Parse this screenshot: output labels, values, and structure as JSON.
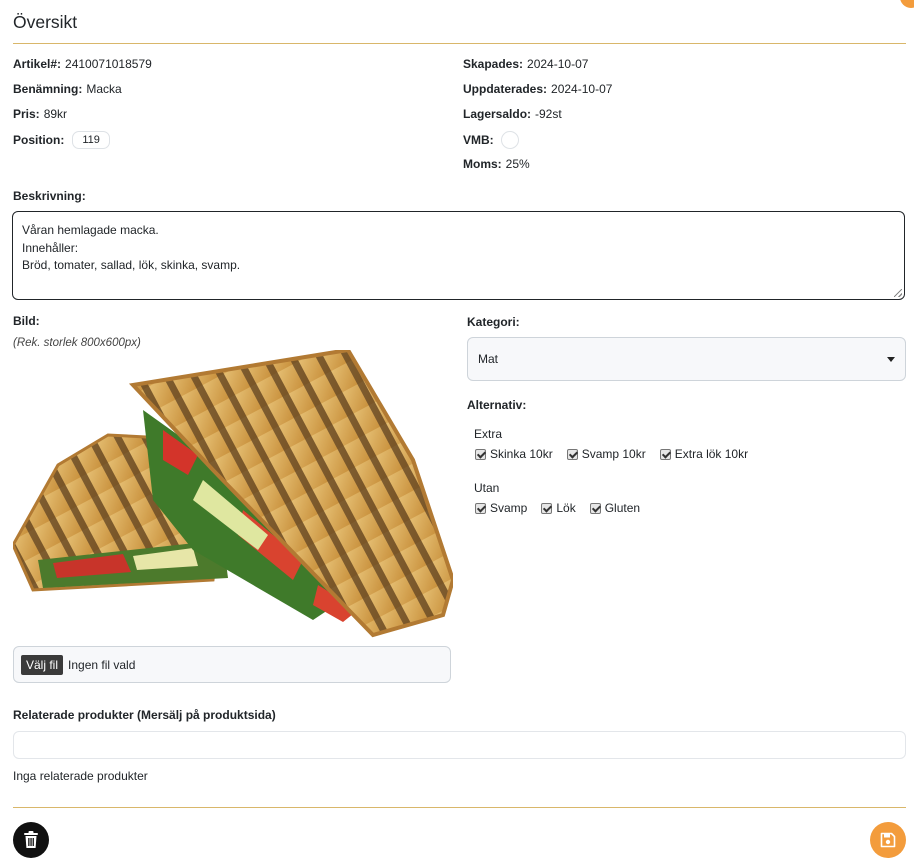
{
  "header": {
    "title": "Översikt"
  },
  "details_left": [
    {
      "label": "Artikel#:",
      "value": "2410071018579"
    },
    {
      "label": "Benämning:",
      "value": "Macka"
    },
    {
      "label": "Pris:",
      "value": "89kr"
    },
    {
      "label": "Position:",
      "value": "119"
    }
  ],
  "details_right": [
    {
      "label": "Skapades:",
      "value": "2024-10-07"
    },
    {
      "label": "Uppdaterades:",
      "value": "2024-10-07"
    },
    {
      "label": "Lagersaldo:",
      "value": "-92st"
    },
    {
      "label": "VMB:",
      "value": ""
    },
    {
      "label": "Moms:",
      "value": "25%"
    }
  ],
  "description": {
    "label": "Beskrivning:",
    "lines": [
      "Våran hemlagade macka.",
      "Innehåller:",
      "Bröd, tomater, sallad, lök, skinka, svamp."
    ]
  },
  "image": {
    "label": "Bild:",
    "hint": "(Rek. storlek 800x600px)",
    "file_button": "Välj fil",
    "file_status": "Ingen fil vald"
  },
  "category": {
    "label": "Kategori:",
    "selected": "Mat"
  },
  "options": {
    "label": "Alternativ:",
    "groups": [
      {
        "title": "Extra",
        "items": [
          {
            "label": "Skinka 10kr",
            "checked": true
          },
          {
            "label": "Svamp 10kr",
            "checked": true
          },
          {
            "label": "Extra lök 10kr",
            "checked": true
          }
        ]
      },
      {
        "title": "Utan",
        "items": [
          {
            "label": "Svamp",
            "checked": true
          },
          {
            "label": "Lök",
            "checked": true
          },
          {
            "label": "Gluten",
            "checked": true
          }
        ]
      }
    ]
  },
  "related": {
    "label": "Relaterade produkter (Mersälj på produktsida)",
    "empty_text": "Inga relaterade produkter"
  },
  "icons": {
    "delete": "trash-icon",
    "save": "floppy-disk-icon"
  },
  "colors": {
    "accent": "#f39c3c",
    "divider": "#d9b76a",
    "delete_button": "#111111"
  }
}
